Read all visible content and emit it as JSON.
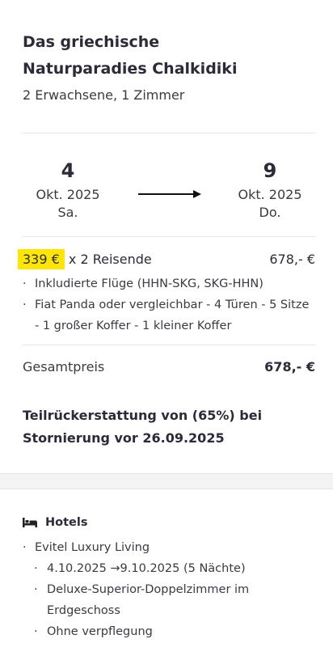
{
  "trip": {
    "title_line1": "Das griechische",
    "title_line2": "Naturparadies Chalkidiki",
    "subtitle": "2 Erwachsene, 1 Zimmer"
  },
  "dates": {
    "start": {
      "day": "4",
      "month": "Okt. 2025",
      "weekday": "Sa."
    },
    "end": {
      "day": "9",
      "month": "Okt. 2025",
      "weekday": "Do."
    }
  },
  "price": {
    "per_person": "339 €",
    "travelers": " x 2 Reisende",
    "line_total": "678,- €",
    "includes": [
      "Inkludierte Flüge (HHN-SKG, SKG-HHN)",
      "Fiat Panda oder vergleichbar - 4 Türen - 5 Sitze - 1 großer Koffer - 1 kleiner Koffer"
    ],
    "total_label": "Gesamtpreis",
    "total_value": "678,- €"
  },
  "refund": {
    "line1": "Teilrückerstattung von (65%) bei",
    "line2": "Stornierung vor 26.09.2025"
  },
  "hotels": {
    "heading": "Hotels",
    "icon": "bed-icon",
    "name": "Evitel Luxury Living",
    "details": [
      "4.10.2025 →9.10.2025 (5 Nächte)",
      "Deluxe-Superior-Doppelzimmer im Erdgeschoss",
      "Ohne verpflegung"
    ]
  },
  "colors": {
    "highlight": "#ffe600",
    "text": "#2b2b3a"
  }
}
